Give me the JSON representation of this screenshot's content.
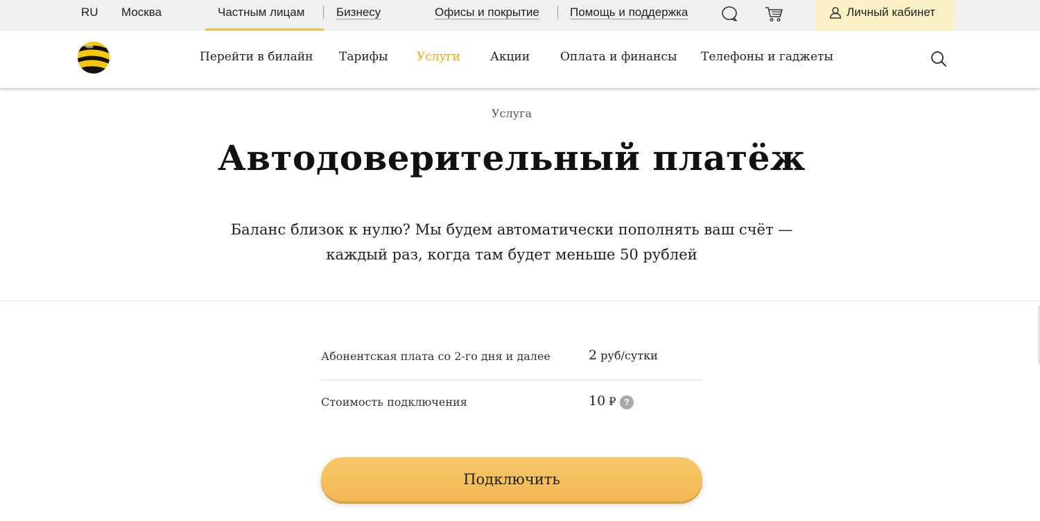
{
  "topbar": {
    "language": "RU",
    "city": "Москва",
    "segments": [
      "Частным лицам",
      "Бизнесу"
    ],
    "links": [
      "Офисы и покрытие",
      "Помощь и поддержка"
    ],
    "cabinet_label": "Личный кабинет"
  },
  "nav": {
    "items": [
      "Перейти в билайн",
      "Тарифы",
      "Услуги",
      "Акции",
      "Оплата и финансы",
      "Телефоны и гаджеты"
    ],
    "active": "Услуги"
  },
  "hero": {
    "eyebrow": "Услуга",
    "title": "Автодоверительный платёж",
    "subtitle": "Баланс близок к нулю? Мы будем автоматически пополнять ваш счёт — каждый раз, когда там будет меньше 50 рублей"
  },
  "pricing": {
    "rows": [
      {
        "label": "Абонентская плата со 2-го дня и далее",
        "amount": "2",
        "unit": " руб/сутки"
      },
      {
        "label": "Стоимость подключения",
        "amount": "10",
        "unit": " ₽"
      }
    ],
    "help_glyph": "?"
  },
  "actions": {
    "connect_label": "Подключить"
  },
  "colors": {
    "brand_yellow": "#f2c043",
    "active_nav": "#f2a813",
    "button": "#f5c060",
    "cabinet_bg": "#fbf1c6"
  }
}
